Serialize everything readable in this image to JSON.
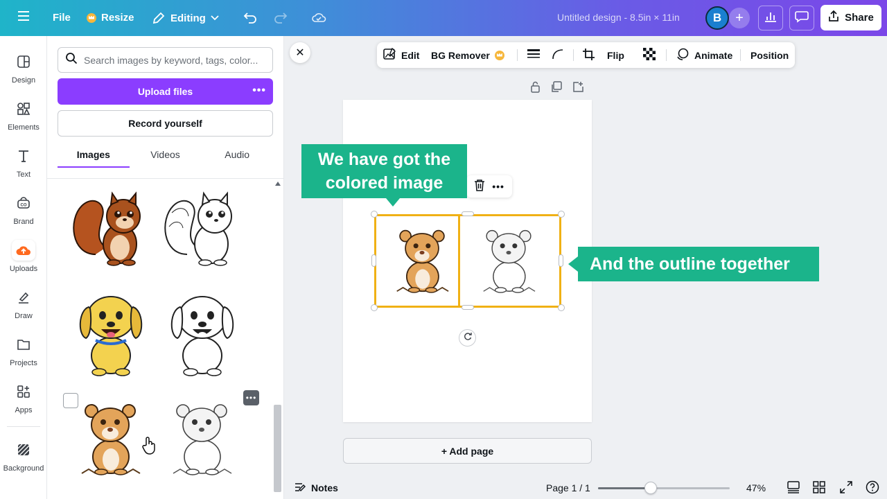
{
  "topbar": {
    "file_label": "File",
    "resize_label": "Resize",
    "editing_label": "Editing",
    "title": "Untitled design - 8.5in × 11in",
    "avatar_initial": "B",
    "share_label": "Share",
    "gradient_colors": [
      "#1fb4c9",
      "#3e8fd8",
      "#6a5be6",
      "#7b47e8"
    ]
  },
  "rail": {
    "items": [
      {
        "label": "Design",
        "icon": "design-icon"
      },
      {
        "label": "Elements",
        "icon": "elements-icon"
      },
      {
        "label": "Text",
        "icon": "text-icon"
      },
      {
        "label": "Brand",
        "icon": "brand-icon"
      },
      {
        "label": "Uploads",
        "icon": "uploads-icon"
      },
      {
        "label": "Draw",
        "icon": "draw-icon"
      },
      {
        "label": "Projects",
        "icon": "projects-icon"
      },
      {
        "label": "Apps",
        "icon": "apps-icon"
      },
      {
        "label": "Background",
        "icon": "background-icon"
      }
    ]
  },
  "panel": {
    "search_placeholder": "Search images by keyword, tags, color...",
    "upload_label": "Upload files",
    "record_label": "Record yourself",
    "tabs": [
      {
        "label": "Images",
        "active": true
      },
      {
        "label": "Videos",
        "active": false
      },
      {
        "label": "Audio",
        "active": false
      }
    ],
    "thumbnails": [
      {
        "name": "squirrel-colored"
      },
      {
        "name": "squirrel-outline"
      },
      {
        "name": "puppy-colored"
      },
      {
        "name": "puppy-outline"
      },
      {
        "name": "lion-cub-colored"
      },
      {
        "name": "lion-cub-outline"
      }
    ],
    "accent_color": "#8b3dff"
  },
  "toolbar": {
    "edit_label": "Edit",
    "bg_remover_label": "BG Remover",
    "flip_label": "Flip",
    "animate_label": "Animate",
    "position_label": "Position"
  },
  "canvas": {
    "callout_1": "We have got the colored image",
    "callout_2": "And the outline together",
    "callout_color": "#1bb48b",
    "selection_color": "#f0b115",
    "add_page_label": "+ Add page"
  },
  "bottombar": {
    "notes_label": "Notes",
    "page_indicator": "Page 1 / 1",
    "zoom_label": "47%",
    "zoom_fraction": 0.4
  }
}
